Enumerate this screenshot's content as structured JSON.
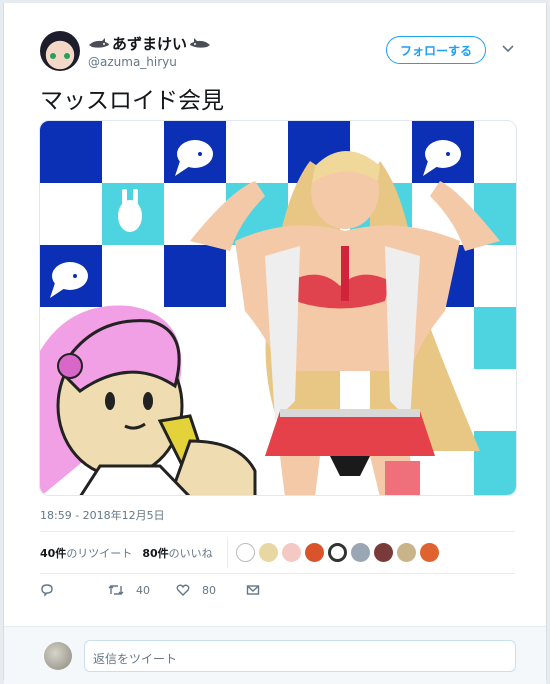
{
  "user": {
    "display_name": "あずまけい",
    "handle": "@azuma_hiryu",
    "avatar_icon": "user-avatar"
  },
  "follow_button": {
    "label": "フォローする"
  },
  "tweet": {
    "text": "マッスロイド会見",
    "timestamp": "18:59 - 2018年12月5日"
  },
  "stats": {
    "retweets_count": "40件",
    "retweets_label": "のリツイート",
    "likes_count": "80件",
    "likes_label": "のいいね"
  },
  "actions": {
    "retweet_count": "40",
    "like_count": "80"
  },
  "reply": {
    "placeholder": "返信をツイート"
  },
  "colors": {
    "accent": "#1da1f2",
    "checker_dark": "#0b2fb5",
    "checker_light": "#4dd4e0"
  }
}
